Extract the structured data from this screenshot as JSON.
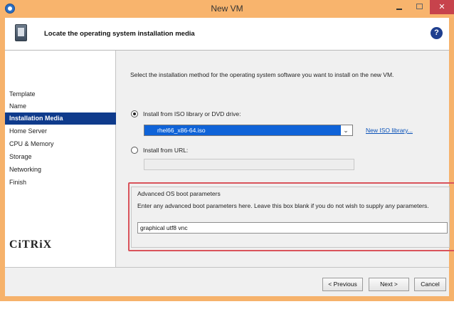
{
  "window": {
    "title": "New VM"
  },
  "header": {
    "title": "Locate the operating system installation media",
    "help": "?"
  },
  "sidebar": {
    "items": [
      {
        "label": "Template",
        "active": false
      },
      {
        "label": "Name",
        "active": false
      },
      {
        "label": "Installation Media",
        "active": true
      },
      {
        "label": "Home Server",
        "active": false
      },
      {
        "label": "CPU & Memory",
        "active": false
      },
      {
        "label": "Storage",
        "active": false
      },
      {
        "label": "Networking",
        "active": false
      },
      {
        "label": "Finish",
        "active": false
      }
    ],
    "logo": "CiTRiX"
  },
  "main": {
    "instruction": "Select the installation method for the operating system software you want to install on the new VM.",
    "option_iso": {
      "label": "Install from ISO library or DVD drive:",
      "selected": true,
      "value": "rhel66_x86-64.iso"
    },
    "new_iso_link": "New ISO library...",
    "option_url": {
      "label": "Install from URL:",
      "selected": false,
      "value": ""
    },
    "advanced": {
      "title": "Advanced OS boot parameters",
      "description": "Enter any advanced boot parameters here. Leave this box blank if you do not wish to supply any parameters.",
      "value": "graphical utf8 vnc"
    }
  },
  "footer": {
    "previous": "< Previous",
    "next": "Next >",
    "cancel": "Cancel"
  },
  "colors": {
    "titlebar": "#f8b46d",
    "selection": "#0f3b8c",
    "highlight": "#d9535b",
    "link": "#0a52b8"
  }
}
